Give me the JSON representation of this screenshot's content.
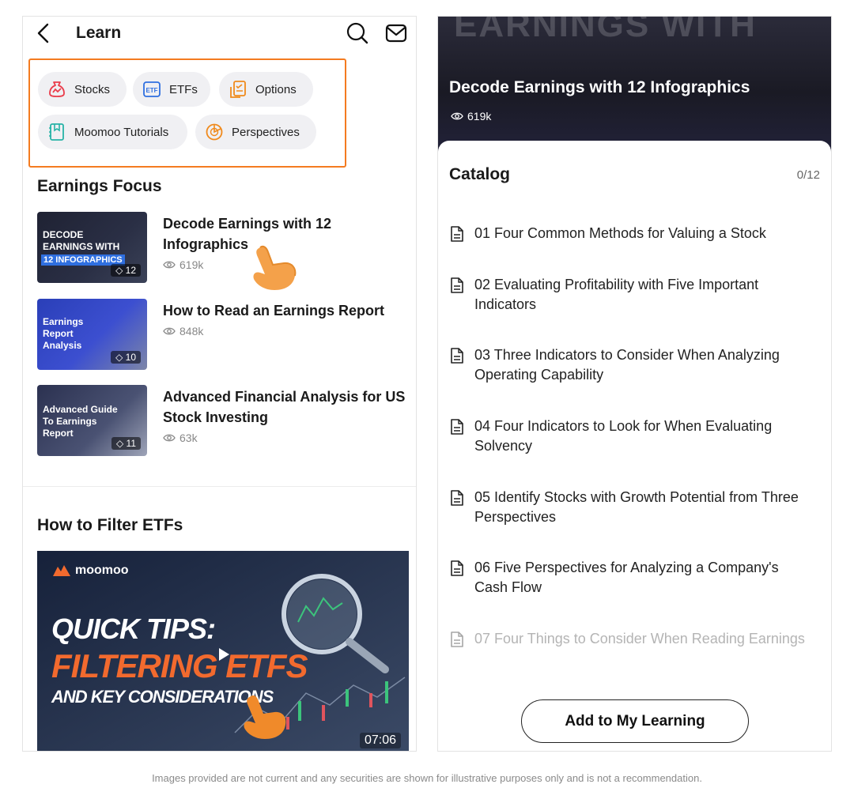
{
  "left": {
    "header": {
      "title": "Learn"
    },
    "categories": [
      {
        "label": "Stocks",
        "icon": "stocks-icon"
      },
      {
        "label": "ETFs",
        "icon": "etf-icon"
      },
      {
        "label": "Options",
        "icon": "options-icon"
      },
      {
        "label": "Moomoo Tutorials",
        "icon": "tutorials-icon"
      },
      {
        "label": "Perspectives",
        "icon": "perspectives-icon"
      }
    ],
    "earnings_focus": {
      "title": "Earnings Focus",
      "articles": [
        {
          "title": "Decode Earnings with 12 Infographics",
          "views": "619k",
          "thumb_text": "DECODE\nEARNINGS WITH",
          "thumb_highlight": "12 INFOGRAPHICS",
          "badge": "12"
        },
        {
          "title": "How to Read an Earnings Report",
          "views": "848k",
          "thumb_text": "Earnings\nReport\nAnalysis",
          "badge": "10"
        },
        {
          "title": "Advanced Financial Analysis for US Stock Investing",
          "views": "63k",
          "thumb_text": "Advanced Guide\nTo Earnings\nReport",
          "badge": "11"
        }
      ]
    },
    "etf_section": {
      "title": "How to Filter ETFs",
      "video": {
        "brand": "moomoo",
        "line1": "QUICK TIPS:",
        "line2": "FILTERING ETFS",
        "line3": "AND KEY CONSIDERATIONS",
        "duration": "07:06"
      }
    }
  },
  "right": {
    "hero": {
      "bg_text": "EARNINGS WITH",
      "title": "Decode Earnings with 12 Infographics",
      "views": "619k"
    },
    "catalog": {
      "title": "Catalog",
      "progress": "0/12",
      "items": [
        "01 Four Common Methods for Valuing a Stock",
        "02 Evaluating Profitability with Five Important Indicators",
        "03 Three Indicators to Consider When Analyzing Operating Capability",
        "04 Four Indicators to Look for When Evaluating Solvency",
        "05 Identify Stocks with Growth Potential from Three Perspectives",
        "06 Five Perspectives for Analyzing a Company's Cash Flow",
        "07 Four Things to Consider When Reading Earnings"
      ]
    },
    "add_button": "Add to My Learning"
  },
  "disclaimer": "Images provided are not current and any securities are shown for illustrative purposes only and is not a recommendation.",
  "colors": {
    "accent_orange": "#f47b20",
    "video_orange": "#f26a2e",
    "etf_blue": "#2f6fe0"
  }
}
